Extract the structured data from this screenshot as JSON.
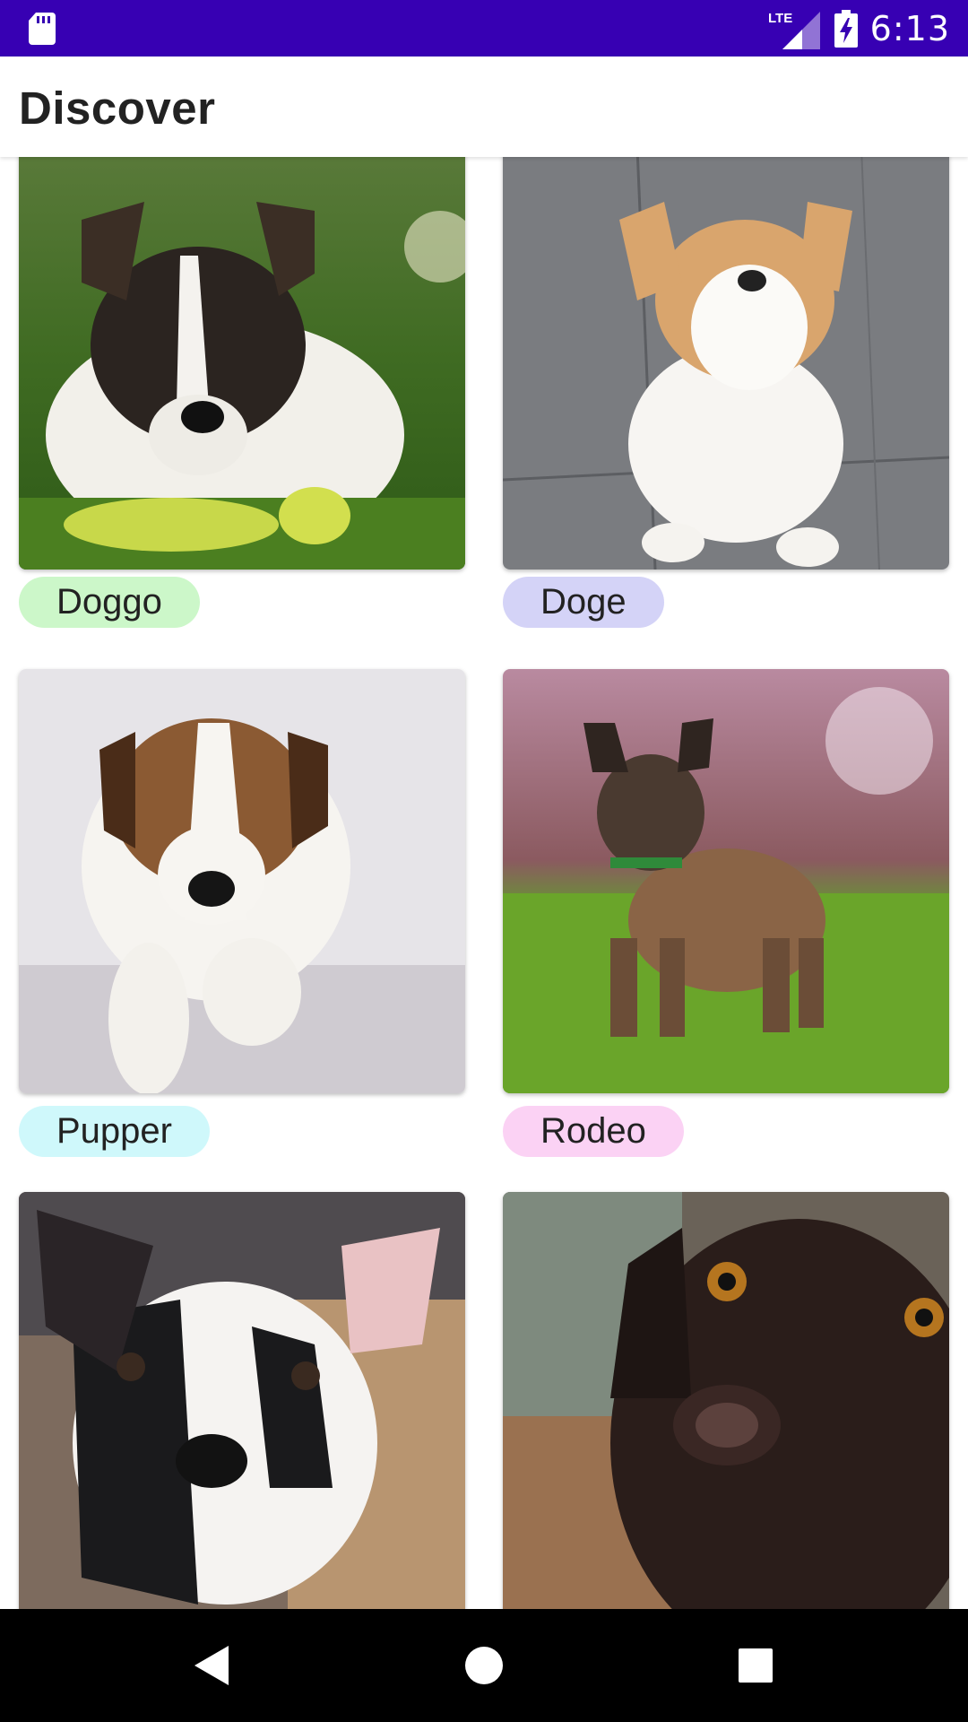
{
  "status_bar": {
    "time": "6:13",
    "network_label": "LTE",
    "background": "#3700b3",
    "icons": [
      "sd-card-icon",
      "signal-icon",
      "battery-charging-icon"
    ]
  },
  "app_bar": {
    "title": "Discover"
  },
  "cards": [
    {
      "name": "Doggo",
      "chip_color": "#ccf7c9",
      "photo": "puppy-photo"
    },
    {
      "name": "Doge",
      "chip_color": "#d4d3f7",
      "photo": "puppy-photo"
    },
    {
      "name": "Pupper",
      "chip_color": "#cff8fb",
      "photo": "puppy-photo"
    },
    {
      "name": "Rodeo",
      "chip_color": "#fbd2f4",
      "photo": "puppy-photo"
    },
    {
      "name": "",
      "chip_color": "",
      "photo": "puppy-photo"
    },
    {
      "name": "",
      "chip_color": "",
      "photo": "puppy-photo"
    }
  ],
  "nav_bar": {
    "buttons": [
      "back-icon",
      "home-icon",
      "recents-icon"
    ]
  }
}
